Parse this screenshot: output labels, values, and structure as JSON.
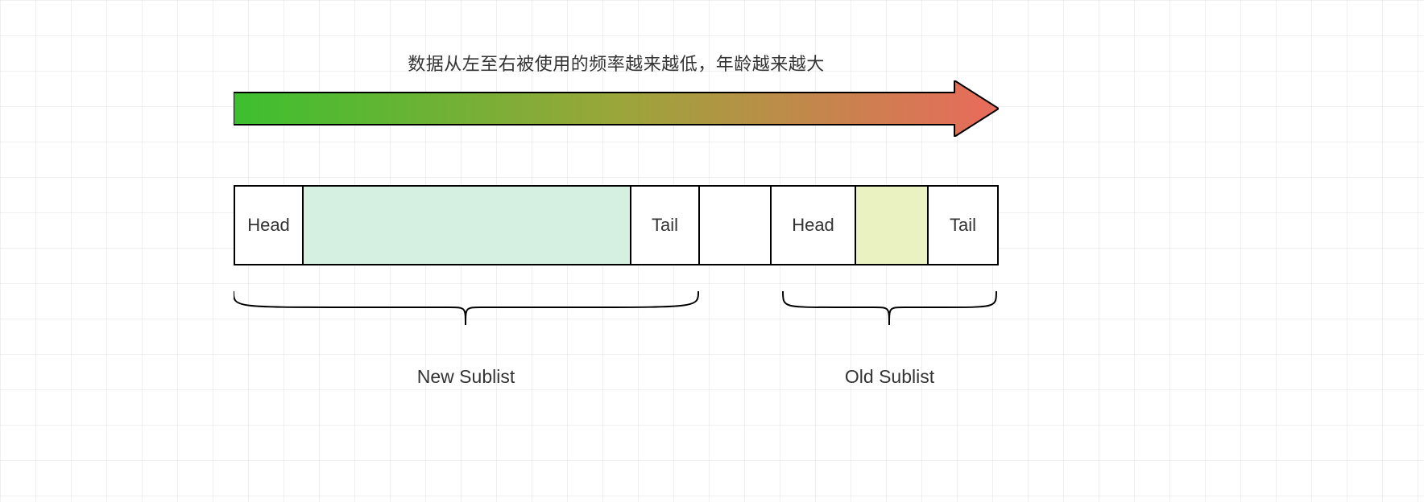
{
  "caption": "数据从左至右被使用的频率越来越低，年龄越来越大",
  "cells": {
    "head1": "Head",
    "tail1": "Tail",
    "head2": "Head",
    "tail2": "Tail"
  },
  "sublists": {
    "new": "New Sublist",
    "old": "Old Sublist"
  },
  "colors": {
    "gradient_start": "#3dbf2f",
    "gradient_end": "#e96a5c",
    "new_body": "#d5f0e1",
    "old_body": "#e9f2c0"
  }
}
